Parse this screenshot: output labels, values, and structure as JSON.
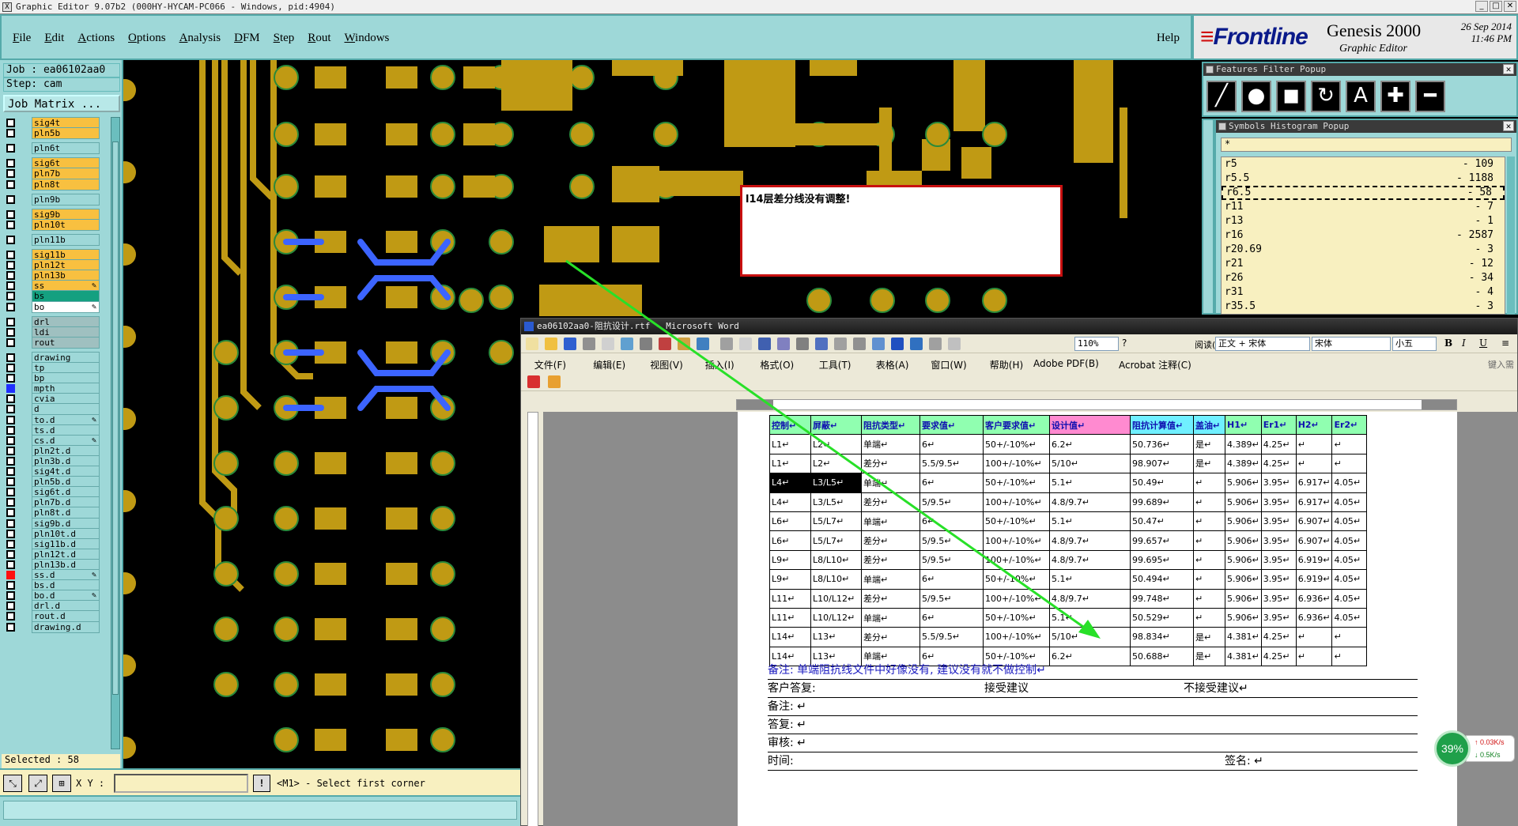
{
  "title_bar": "Graphic Editor 9.07b2 (000HY-HYCAM-PC066 - Windows, pid:4904)",
  "menu": [
    "File",
    "Edit",
    "Actions",
    "Options",
    "Analysis",
    "DFM",
    "Step",
    "Rout",
    "Windows"
  ],
  "help": "Help",
  "brand": {
    "logo_a": "Frontline",
    "product": "Genesis 2000",
    "subtitle": "Graphic Editor",
    "date": "26 Sep 2014",
    "time": "11:46 PM"
  },
  "job": {
    "job": "Job : ea06102aa0",
    "step": "Step: cam",
    "matrix_button": "Job Matrix ..."
  },
  "layers": [
    {
      "name": "sig4t",
      "style": "sig",
      "edit": ""
    },
    {
      "name": "pln5b",
      "style": "sig",
      "edit": ""
    },
    {
      "name": "pln6t",
      "style": "",
      "edit": ""
    },
    {
      "name": "sig6t",
      "style": "sig",
      "edit": ""
    },
    {
      "name": "pln7b",
      "style": "sig",
      "edit": ""
    },
    {
      "name": "pln8t",
      "style": "sig",
      "edit": ""
    },
    {
      "name": "pln9b",
      "style": "",
      "edit": ""
    },
    {
      "name": "sig9b",
      "style": "sig",
      "edit": ""
    },
    {
      "name": "pln10t",
      "style": "sig",
      "edit": ""
    },
    {
      "name": "pln11b",
      "style": "",
      "edit": ""
    },
    {
      "name": "sig11b",
      "style": "sig",
      "edit": ""
    },
    {
      "name": "pln12t",
      "style": "sig",
      "edit": ""
    },
    {
      "name": "pln13b",
      "style": "sig",
      "edit": ""
    },
    {
      "name": "ss",
      "style": "sig",
      "edit": "✎"
    },
    {
      "name": "bs",
      "style": "grn",
      "edit": ""
    },
    {
      "name": "bo",
      "style": "wht",
      "edit": "✎"
    },
    {
      "name": "drl",
      "style": "gry",
      "edit": ""
    },
    {
      "name": "ldi",
      "style": "gry",
      "edit": ""
    },
    {
      "name": "rout",
      "style": "gry",
      "edit": ""
    },
    {
      "name": "drawing",
      "style": "",
      "edit": ""
    },
    {
      "name": "tp",
      "style": "",
      "edit": ""
    },
    {
      "name": "bp",
      "style": "",
      "edit": ""
    },
    {
      "name": "mpth",
      "style": "",
      "edit": ""
    },
    {
      "name": "cvia",
      "style": "",
      "edit": ""
    },
    {
      "name": "d",
      "style": "",
      "edit": ""
    },
    {
      "name": "to.d",
      "style": "",
      "edit": "✎"
    },
    {
      "name": "ts.d",
      "style": "",
      "edit": ""
    },
    {
      "name": "cs.d",
      "style": "",
      "edit": "✎"
    },
    {
      "name": "pln2t.d",
      "style": "",
      "edit": ""
    },
    {
      "name": "pln3b.d",
      "style": "",
      "edit": ""
    },
    {
      "name": "sig4t.d",
      "style": "",
      "edit": ""
    },
    {
      "name": "pln5b.d",
      "style": "",
      "edit": ""
    },
    {
      "name": "sig6t.d",
      "style": "",
      "edit": ""
    },
    {
      "name": "pln7b.d",
      "style": "",
      "edit": ""
    },
    {
      "name": "pln8t.d",
      "style": "",
      "edit": ""
    },
    {
      "name": "sig9b.d",
      "style": "",
      "edit": ""
    },
    {
      "name": "pln10t.d",
      "style": "",
      "edit": ""
    },
    {
      "name": "sig11b.d",
      "style": "",
      "edit": ""
    },
    {
      "name": "pln12t.d",
      "style": "",
      "edit": ""
    },
    {
      "name": "pln13b.d",
      "style": "",
      "edit": ""
    },
    {
      "name": "ss.d",
      "style": "",
      "edit": "✎"
    },
    {
      "name": "bs.d",
      "style": "",
      "edit": ""
    },
    {
      "name": "bo.d",
      "style": "",
      "edit": "✎"
    },
    {
      "name": "drl.d",
      "style": "",
      "edit": ""
    },
    {
      "name": "rout.d",
      "style": "",
      "edit": ""
    },
    {
      "name": "drawing.d",
      "style": "",
      "edit": ""
    }
  ],
  "selected": "Selected : 58",
  "status": {
    "xy_label": "X Y :",
    "bang": "!",
    "message": "<M1> - Select first corner"
  },
  "features_popup": {
    "title": "Features Filter Popup",
    "close": "✕"
  },
  "histogram": {
    "title": "Symbols Histogram Popup",
    "close": "✕",
    "filter": "*",
    "rows": [
      {
        "sym": "r5",
        "count": "- 109"
      },
      {
        "sym": "r5.5",
        "count": "- 1188"
      },
      {
        "sym": "r6.5",
        "count": "- 58"
      },
      {
        "sym": "r11",
        "count": "- 7"
      },
      {
        "sym": "r13",
        "count": "- 1"
      },
      {
        "sym": "r16",
        "count": "- 2587"
      },
      {
        "sym": "r20.69",
        "count": "- 3"
      },
      {
        "sym": "r21",
        "count": "- 12"
      },
      {
        "sym": "r26",
        "count": "- 34"
      },
      {
        "sym": "r31",
        "count": "- 4"
      },
      {
        "sym": "r35.5",
        "count": "- 3"
      }
    ]
  },
  "note": "l14层差分线没有调整!",
  "word": {
    "title": "ea06102aa0-阻抗设计.rtf - Microsoft Word",
    "menus": [
      "文件(F)",
      "编辑(E)",
      "视图(V)",
      "插入(I)",
      "格式(O)",
      "工具(T)",
      "表格(A)",
      "窗口(W)",
      "帮助(H)",
      "Adobe PDF(B)",
      "Acrobat 注释(C)"
    ],
    "zoom": "110%",
    "read": "阅读(R)",
    "style": "正文 + 宋体",
    "font": "宋体",
    "size": "小五",
    "help_box": "键入需",
    "table_header": [
      "控制↵",
      "屏蔽↵",
      "阻抗类型↵",
      "要求值↵",
      "客户要求值↵",
      "设计值↵",
      "阻抗计算值↵",
      "盖油↵",
      "H1↵",
      "Er1↵",
      "H2↵",
      "Er2↵"
    ],
    "table_rows": [
      [
        "L1↵",
        "L2↵",
        "单端↵",
        "6↵",
        "50+/-10%↵",
        "6.2↵",
        "50.736↵",
        "是↵",
        "4.389↵",
        "4.25↵",
        "↵",
        "↵"
      ],
      [
        "L1↵",
        "L2↵",
        "差分↵",
        "5.5/9.5↵",
        "100+/-10%↵",
        "5/10↵",
        "98.907↵",
        "是↵",
        "4.389↵",
        "4.25↵",
        "↵",
        "↵"
      ],
      [
        "L4↵",
        "L3/L5↵",
        "单端↵",
        "6↵",
        "50+/-10%↵",
        "5.1↵",
        "50.49↵",
        "↵",
        "5.906↵",
        "3.95↵",
        "6.917↵",
        "4.05↵"
      ],
      [
        "L4↵",
        "L3/L5↵",
        "差分↵",
        "5/9.5↵",
        "100+/-10%↵",
        "4.8/9.7↵",
        "99.689↵",
        "↵",
        "5.906↵",
        "3.95↵",
        "6.917↵",
        "4.05↵"
      ],
      [
        "L6↵",
        "L5/L7↵",
        "单端↵",
        "6↵",
        "50+/-10%↵",
        "5.1↵",
        "50.47↵",
        "↵",
        "5.906↵",
        "3.95↵",
        "6.907↵",
        "4.05↵"
      ],
      [
        "L6↵",
        "L5/L7↵",
        "差分↵",
        "5/9.5↵",
        "100+/-10%↵",
        "4.8/9.7↵",
        "99.657↵",
        "↵",
        "5.906↵",
        "3.95↵",
        "6.907↵",
        "4.05↵"
      ],
      [
        "L9↵",
        "L8/L10↵",
        "差分↵",
        "5/9.5↵",
        "100+/-10%↵",
        "4.8/9.7↵",
        "99.695↵",
        "↵",
        "5.906↵",
        "3.95↵",
        "6.919↵",
        "4.05↵"
      ],
      [
        "L9↵",
        "L8/L10↵",
        "单端↵",
        "6↵",
        "50+/-10%↵",
        "5.1↵",
        "50.494↵",
        "↵",
        "5.906↵",
        "3.95↵",
        "6.919↵",
        "4.05↵"
      ],
      [
        "L11↵",
        "L10/L12↵",
        "差分↵",
        "5/9.5↵",
        "100+/-10%↵",
        "4.8/9.7↵",
        "99.748↵",
        "↵",
        "5.906↵",
        "3.95↵",
        "6.936↵",
        "4.05↵"
      ],
      [
        "L11↵",
        "L10/L12↵",
        "单端↵",
        "6↵",
        "50+/-10%↵",
        "5.1↵",
        "50.529↵",
        "↵",
        "5.906↵",
        "3.95↵",
        "6.936↵",
        "4.05↵"
      ],
      [
        "L14↵",
        "L13↵",
        "差分↵",
        "5.5/9.5↵",
        "100+/-10%↵",
        "5/10↵",
        "98.834↵",
        "是↵",
        "4.381↵",
        "4.25↵",
        "↵",
        "↵"
      ],
      [
        "L14↵",
        "L13↵",
        "单端↵",
        "6↵",
        "50+/-10%↵",
        "6.2↵",
        "50.688↵",
        "是↵",
        "4.381↵",
        "4.25↵",
        "↵",
        "↵"
      ]
    ],
    "remark_blue": "备注: 单端阻抗线文件中好像没有, 建议没有就不做控制↵",
    "reply_label": "客户答复:",
    "accept": "接受建议",
    "reject": "不接受建议↵",
    "remark": "备注: ↵",
    "answer": "答复: ↵",
    "review": "审核: ↵",
    "time": "时间:",
    "sign": "签名: ↵"
  },
  "speed": {
    "percent": "39%",
    "up": "0.03K/s",
    "down": "0.5K/s"
  },
  "colors": {
    "copper": "#c09a14",
    "trace_blue": "#3c64ff",
    "panel": "#9ed8d8",
    "arrow": "#28e028"
  }
}
